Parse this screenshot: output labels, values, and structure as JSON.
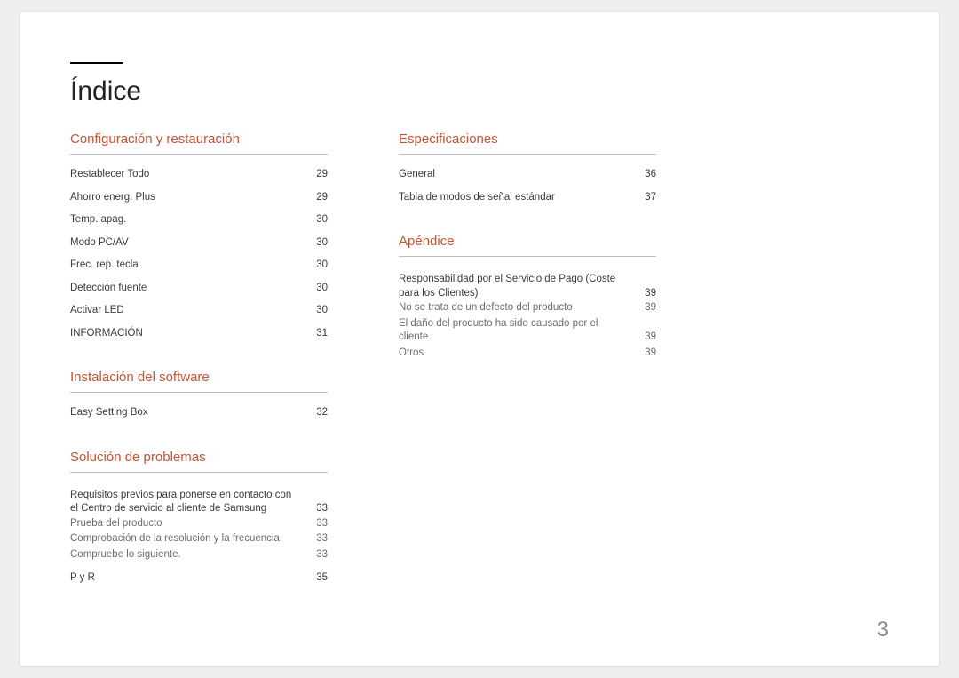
{
  "title": "Índice",
  "page_number": "3",
  "col1": {
    "sec1": {
      "title": "Configuración y restauración",
      "items": [
        {
          "label": "Restablecer Todo",
          "page": "29"
        },
        {
          "label": "Ahorro energ. Plus",
          "page": "29"
        },
        {
          "label": "Temp. apag.",
          "page": "30"
        },
        {
          "label": "Modo PC/AV",
          "page": "30"
        },
        {
          "label": "Frec. rep. tecla",
          "page": "30"
        },
        {
          "label": "Detección fuente",
          "page": "30"
        },
        {
          "label": "Activar LED",
          "page": "30"
        },
        {
          "label": "INFORMACIÓN",
          "page": "31"
        }
      ]
    },
    "sec2": {
      "title": "Instalación del software",
      "items": [
        {
          "label": "Easy Setting Box",
          "page": "32"
        }
      ]
    },
    "sec3": {
      "title": "Solución de problemas",
      "items": [
        {
          "label": "Requisitos previos para ponerse en contacto con el Centro de servicio al cliente de Samsung",
          "page": "33",
          "subs": [
            {
              "label": "Prueba del producto",
              "page": "33"
            },
            {
              "label": "Comprobación de la resolución y la frecuencia",
              "page": "33"
            },
            {
              "label": "Compruebe lo siguiente.",
              "page": "33"
            }
          ]
        },
        {
          "label": "P y R",
          "page": "35"
        }
      ]
    }
  },
  "col2": {
    "sec1": {
      "title": "Especificaciones",
      "items": [
        {
          "label": "General",
          "page": "36"
        },
        {
          "label": "Tabla de modos de señal estándar",
          "page": "37"
        }
      ]
    },
    "sec2": {
      "title": "Apéndice",
      "items": [
        {
          "label": "Responsabilidad por el Servicio de Pago (Coste para los Clientes)",
          "page": "39",
          "subs": [
            {
              "label": "No se trata de un defecto del producto",
              "page": "39"
            },
            {
              "label": "El daño del producto ha sido causado por el cliente",
              "page": "39"
            },
            {
              "label": "Otros",
              "page": "39"
            }
          ]
        }
      ]
    }
  }
}
